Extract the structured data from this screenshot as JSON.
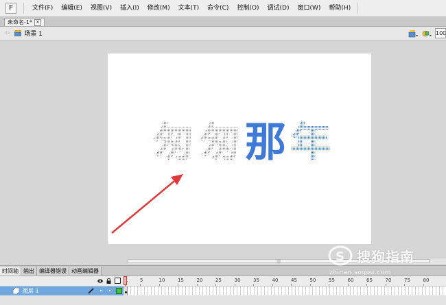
{
  "menubar": {
    "items": [
      "文件(F)",
      "编辑(E)",
      "视图(V)",
      "插入(I)",
      "修改(M)",
      "文本(T)",
      "命令(C)",
      "控制(O)",
      "调试(D)",
      "窗口(W)",
      "帮助(H)"
    ]
  },
  "document": {
    "tab_title": "未命名-1*"
  },
  "scene": {
    "label": "场景 1",
    "zoom": "100"
  },
  "stage": {
    "words": [
      {
        "text": "匆",
        "style": "outline-dotted"
      },
      {
        "text": "匆",
        "style": "outline-dotted"
      },
      {
        "text": "那",
        "style": "solid-blue"
      },
      {
        "text": "年",
        "style": "dotted-blue"
      }
    ],
    "colors": {
      "gray_dots": "#9a9a9a",
      "blue": "#3f7ad8",
      "arrow": "#e0393a"
    }
  },
  "panels": {
    "tabs": [
      "时间轴",
      "输出",
      "编译器错误",
      "动画编辑器"
    ]
  },
  "timeline": {
    "frame_numbers": [
      "1",
      "5",
      "10",
      "15",
      "20",
      "25",
      "30",
      "35",
      "40",
      "45",
      "50",
      "55",
      "60",
      "65",
      "70",
      "75",
      "80"
    ],
    "layer": {
      "name": "图层 1"
    }
  },
  "watermark": {
    "brand": "搜狗指南",
    "url": "zhinan.sogou.com"
  }
}
